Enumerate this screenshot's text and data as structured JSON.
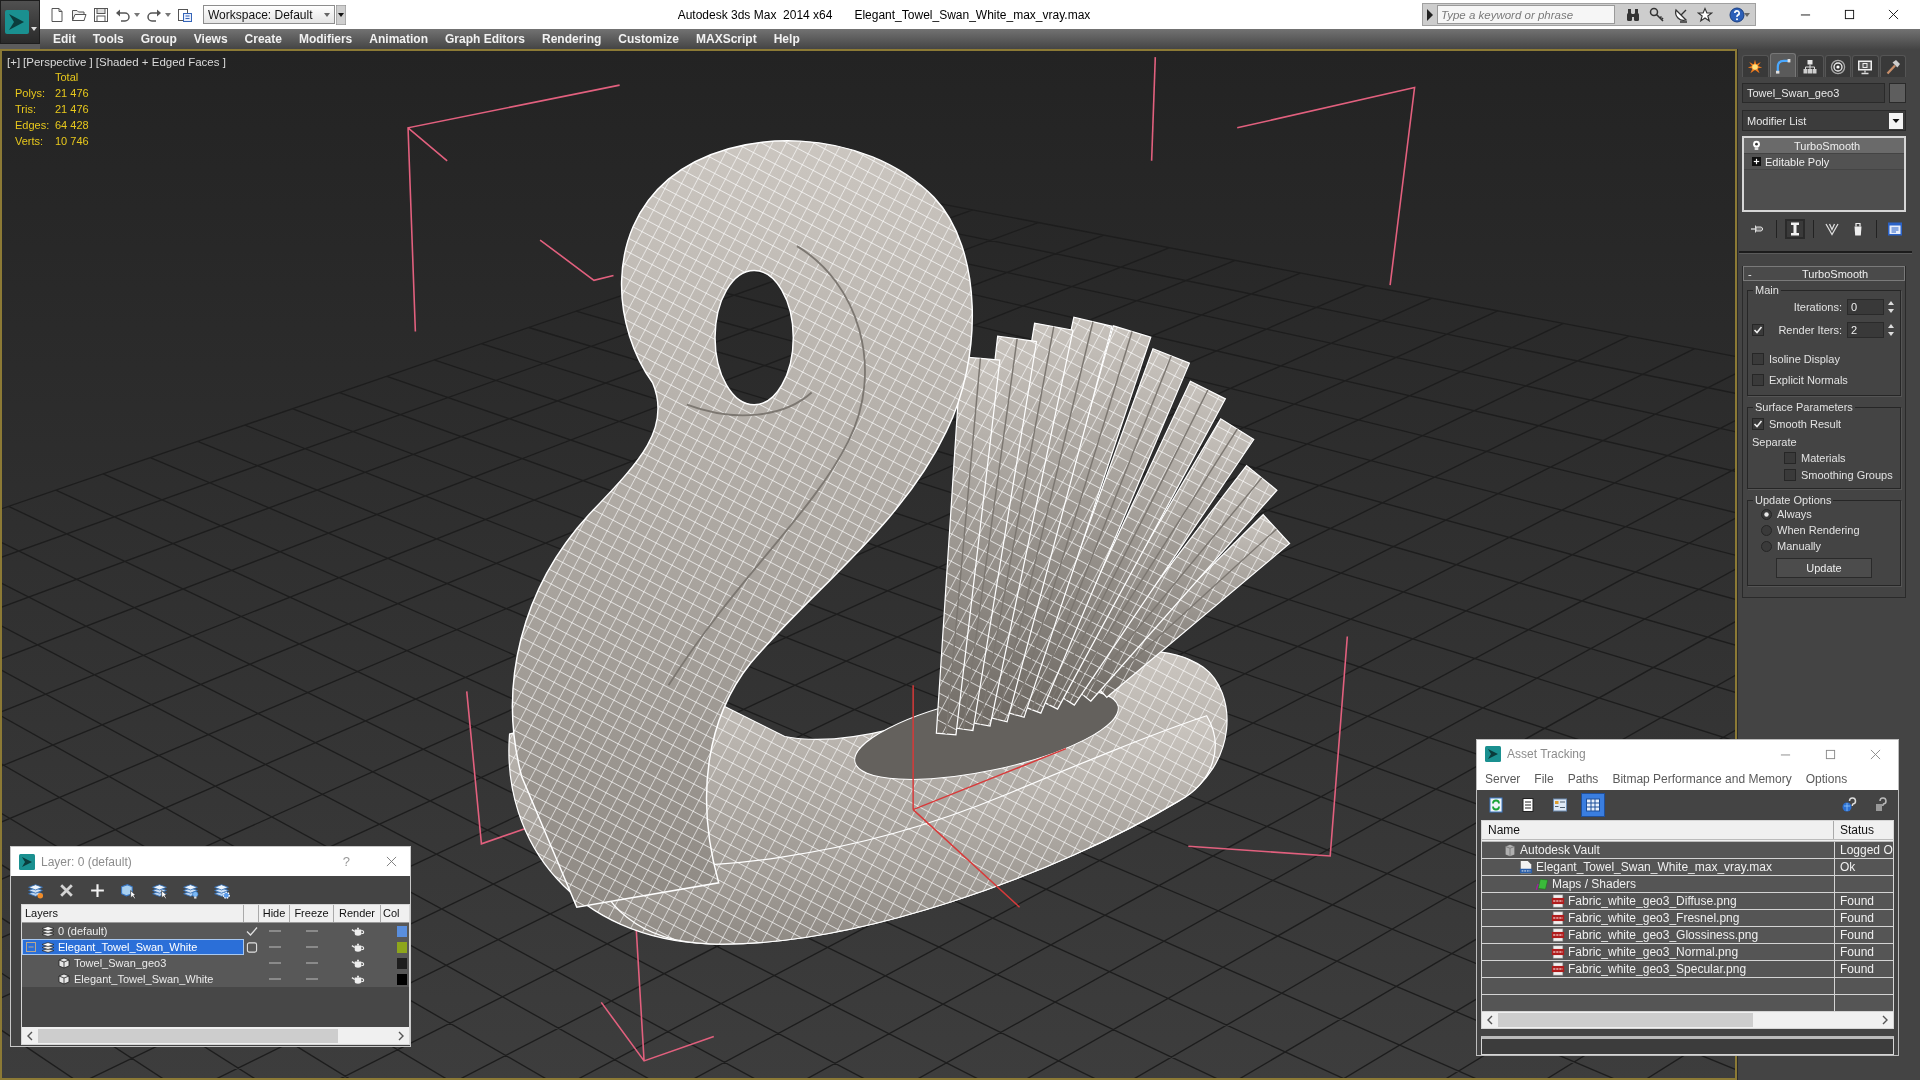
{
  "title_bar": {
    "workspace": "Workspace: Default",
    "app_name": "Autodesk 3ds Max  2014 x64",
    "file_name": "Elegant_Towel_Swan_White_max_vray.max",
    "search": {
      "placeholder": "Type a keyword or phrase"
    }
  },
  "menu_bar": {
    "items": [
      "Edit",
      "Tools",
      "Group",
      "Views",
      "Create",
      "Modifiers",
      "Animation",
      "Graph Editors",
      "Rendering",
      "Customize",
      "MAXScript",
      "Help"
    ]
  },
  "viewport": {
    "labels": [
      "[+]",
      "[Perspective ]",
      "[Shaded + Edged Faces ]"
    ],
    "stats": {
      "header": "Total",
      "rows": [
        {
          "label": "Polys:",
          "value": "21 476"
        },
        {
          "label": "Tris:",
          "value": "21 476"
        },
        {
          "label": "Edges:",
          "value": "64 428"
        },
        {
          "label": "Verts:",
          "value": "10 746"
        }
      ]
    }
  },
  "command_panel": {
    "tabs": [
      {
        "kind": "create",
        "selected": false
      },
      {
        "kind": "modify",
        "selected": true
      },
      {
        "kind": "hierarchy",
        "selected": false
      },
      {
        "kind": "motion",
        "selected": false
      },
      {
        "kind": "display",
        "selected": false
      },
      {
        "kind": "utilities",
        "selected": false
      }
    ],
    "object_name": "Towel_Swan_geo3",
    "modifier_list": "Modifier List",
    "stack": [
      {
        "name": "TurboSmooth",
        "kind": "modifier",
        "selected": true
      },
      {
        "name": "Editable Poly",
        "kind": "base",
        "selected": false,
        "expanded": false
      }
    ],
    "stack_tools": [
      {
        "kind": "pin",
        "selected": false
      },
      {
        "kind": "show_end_result",
        "selected": true
      },
      {
        "kind": "make_unique",
        "selected": false
      },
      {
        "kind": "remove",
        "selected": false
      },
      {
        "kind": "configure",
        "selected": false
      }
    ],
    "rollout": {
      "title": "TurboSmooth",
      "collapse": "-",
      "groups": [
        {
          "title": "Main",
          "controls": [
            {
              "kind": "spinner",
              "label": "Iterations:",
              "value": "0"
            },
            {
              "kind": "check_spinner",
              "label": "Render Iters:",
              "checked": true,
              "value": "2"
            },
            {
              "kind": "checkbox",
              "label": "Isoline Display",
              "checked": false
            },
            {
              "kind": "checkbox",
              "label": "Explicit Normals",
              "checked": false
            }
          ]
        },
        {
          "title": "Surface Parameters",
          "controls": [
            {
              "kind": "checkbox",
              "label": "Smooth Result",
              "checked": true
            },
            {
              "kind": "label",
              "label": "Separate"
            },
            {
              "kind": "sub_checkbox",
              "label": "Materials",
              "checked": false
            },
            {
              "kind": "sub_checkbox",
              "label": "Smoothing Groups",
              "checked": false
            }
          ]
        },
        {
          "title": "Update Options",
          "controls": [
            {
              "kind": "radio",
              "label": "Always",
              "selected": true
            },
            {
              "kind": "radio",
              "label": "When Rendering",
              "selected": false
            },
            {
              "kind": "radio",
              "label": "Manually",
              "selected": false
            },
            {
              "kind": "button",
              "label": "Update"
            }
          ]
        }
      ]
    }
  },
  "layer_dialog": {
    "title": "Layer: 0 (default)",
    "help": "?",
    "toolbar": [
      {
        "kind": "new_layer"
      },
      {
        "kind": "delete"
      },
      {
        "kind": "add"
      },
      {
        "kind": "select_objects"
      },
      {
        "kind": "select_layer"
      },
      {
        "kind": "highlight"
      },
      {
        "kind": "hide_all"
      }
    ],
    "columns": [
      "Layers",
      "Hide",
      "Freeze",
      "Render",
      "Col"
    ],
    "rows": [
      {
        "name": "0 (default)",
        "kind": "layer",
        "active": true,
        "selected": false,
        "hidden": false,
        "frozen": false,
        "renderable": true,
        "color": "#5a8fde"
      },
      {
        "name": "Elegant_Towel_Swan_White",
        "kind": "layer",
        "active": false,
        "selected": true,
        "expanded": true,
        "hidden": false,
        "frozen": false,
        "renderable": true,
        "color": "#8ea61c",
        "children": [
          {
            "name": "Towel_Swan_geo3",
            "kind": "object",
            "selected": false,
            "hidden": false,
            "frozen": false,
            "renderable": true,
            "color": "#1e1e1e"
          },
          {
            "name": "Elegant_Towel_Swan_White",
            "kind": "object",
            "selected": false,
            "hidden": false,
            "frozen": false,
            "renderable": true,
            "color": "#000000"
          }
        ]
      }
    ]
  },
  "asset_tracking": {
    "title": "Asset Tracking",
    "menu": [
      "Server",
      "File",
      "Paths",
      "Bitmap Performance and Memory",
      "Options"
    ],
    "toolbar": [
      {
        "kind": "refresh",
        "selected": false
      },
      {
        "kind": "list",
        "selected": false
      },
      {
        "kind": "thumbnails",
        "selected": false
      },
      {
        "kind": "table",
        "selected": true
      }
    ],
    "columns": [
      "Name",
      "Status"
    ],
    "rows": [
      {
        "name": "Autodesk Vault",
        "kind": "vault",
        "status": "Logged O",
        "children": [
          {
            "name": "Elegant_Towel_Swan_White_max_vray.max",
            "kind": "max_file",
            "status": "Ok",
            "children": [
              {
                "name": "Maps / Shaders",
                "kind": "folder",
                "children": [
                  {
                    "name": "Fabric_white_geo3_Diffuse.png",
                    "kind": "png",
                    "status": "Found"
                  },
                  {
                    "name": "Fabric_white_geo3_Fresnel.png",
                    "kind": "png",
                    "status": "Found"
                  },
                  {
                    "name": "Fabric_white_geo3_Glossiness.png",
                    "kind": "png",
                    "status": "Found"
                  },
                  {
                    "name": "Fabric_white_geo3_Normal.png",
                    "kind": "png",
                    "status": "Found"
                  },
                  {
                    "name": "Fabric_white_geo3_Specular.png",
                    "kind": "png",
                    "status": "Found"
                  }
                ]
              }
            ]
          }
        ]
      }
    ]
  }
}
